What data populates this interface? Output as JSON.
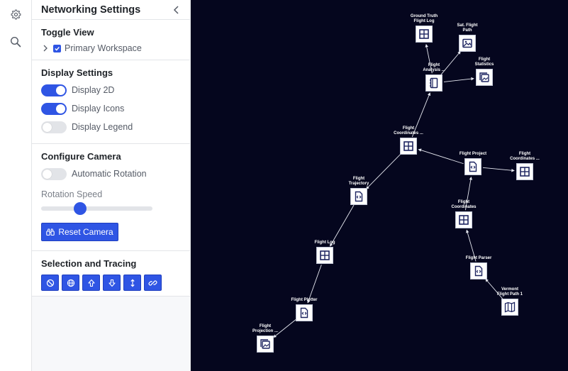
{
  "rail": {
    "settings_icon": "gear-icon",
    "search_icon": "search-icon"
  },
  "panel": {
    "title": "Networking Settings",
    "toggle_view": {
      "title": "Toggle View",
      "workspace_label": "Primary Workspace",
      "workspace_checked": true
    },
    "display_settings": {
      "title": "Display Settings",
      "toggles": [
        {
          "label": "Display 2D",
          "on": true
        },
        {
          "label": "Display Icons",
          "on": true
        },
        {
          "label": "Display Legend",
          "on": false
        }
      ]
    },
    "camera": {
      "title": "Configure Camera",
      "auto_rotation_label": "Automatic Rotation",
      "auto_rotation_on": false,
      "rotation_speed_label": "Rotation Speed",
      "rotation_speed_value": 0.33,
      "reset_label": "Reset Camera"
    },
    "selection": {
      "title": "Selection and Tracing",
      "tools": [
        "clear-selection-icon",
        "globe-icon",
        "arrow-up-icon",
        "arrow-down-icon",
        "arrows-vertical-icon",
        "link-icon"
      ]
    }
  },
  "graph": {
    "colors": {
      "background": "#05061e",
      "node_fill": "#ffffff",
      "node_icon": "#1d2460",
      "edge": "#e6e8f0"
    },
    "nodes": [
      {
        "id": "ground-truth",
        "label": "Ground Truth\nFlight Log",
        "icon": "table-icon"
      },
      {
        "id": "sat-flight-path",
        "label": "Sat. Flight\nPath",
        "icon": "image-icon"
      },
      {
        "id": "flight-statistics",
        "label": "Flight\nStatistics",
        "icon": "gallery-icon"
      },
      {
        "id": "flight-analysis",
        "label": "Flight\nAnalysis ...",
        "icon": "notebook-icon"
      },
      {
        "id": "flight-coordinates-1",
        "label": "Flight\nCoordinates ...",
        "icon": "table-icon"
      },
      {
        "id": "flight-project",
        "label": "Flight Project",
        "icon": "code-file-icon"
      },
      {
        "id": "flight-coordinates-2",
        "label": "Flight\nCoordinates ...",
        "icon": "table-icon"
      },
      {
        "id": "flight-trajectory",
        "label": "Flight\nTrajectory",
        "icon": "code-file-icon"
      },
      {
        "id": "flight-coordinates-3",
        "label": "Flight\nCoordinates",
        "icon": "table-icon"
      },
      {
        "id": "flight-log",
        "label": "Flight Log",
        "icon": "table-icon"
      },
      {
        "id": "flight-parser",
        "label": "Flight Parser",
        "icon": "code-file-icon"
      },
      {
        "id": "vermont-flight-path",
        "label": "Vermont\nFlight Path 1",
        "icon": "map-icon"
      },
      {
        "id": "flight-plotter",
        "label": "Flight Plotter",
        "icon": "code-file-icon"
      },
      {
        "id": "flight-projection",
        "label": "Flight\nProjection ...",
        "icon": "gallery-icon"
      }
    ],
    "edges": [
      [
        "flight-analysis",
        "ground-truth"
      ],
      [
        "flight-analysis",
        "sat-flight-path"
      ],
      [
        "flight-analysis",
        "flight-statistics"
      ],
      [
        "flight-coordinates-1",
        "flight-analysis"
      ],
      [
        "flight-project",
        "flight-coordinates-1"
      ],
      [
        "flight-project",
        "flight-coordinates-2"
      ],
      [
        "flight-coordinates-1",
        "flight-trajectory"
      ],
      [
        "flight-coordinates-3",
        "flight-project"
      ],
      [
        "flight-trajectory",
        "flight-log"
      ],
      [
        "flight-parser",
        "flight-coordinates-3"
      ],
      [
        "vermont-flight-path",
        "flight-parser"
      ],
      [
        "flight-log",
        "flight-plotter"
      ],
      [
        "flight-plotter",
        "flight-projection"
      ]
    ]
  }
}
